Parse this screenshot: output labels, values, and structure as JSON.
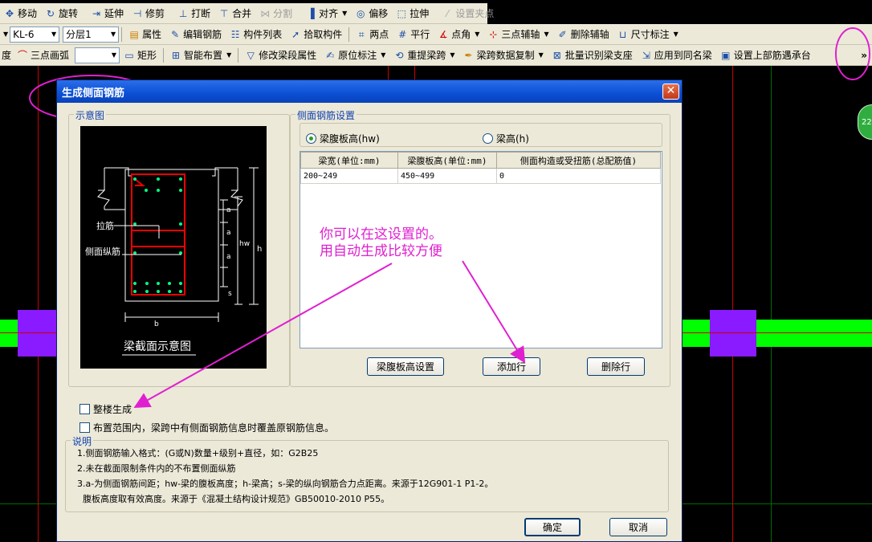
{
  "toolbar1": {
    "items": [
      "移动",
      "旋转",
      "延伸",
      "修剪",
      "打断",
      "合并",
      "分割",
      "对齐",
      "偏移",
      "拉伸",
      "设置夹点"
    ]
  },
  "toolbar2": {
    "component_select": "KL-6",
    "layer_select": "分层1",
    "items": [
      "属性",
      "编辑钢筋",
      "构件列表",
      "拾取构件",
      "两点",
      "平行",
      "点角",
      "三点辅轴",
      "删除辅轴",
      "尺寸标注"
    ]
  },
  "toolbar3": {
    "items": [
      "度",
      "三点画弧",
      "矩形",
      "智能布置",
      "修改梁段属性",
      "原位标注",
      "重提梁跨",
      "梁跨数据复制",
      "批量识别梁支座",
      "应用到同名梁",
      "设置上部筋遇承台"
    ],
    "overflow": "»"
  },
  "dialog": {
    "title": "生成侧面钢筋",
    "close": "✕",
    "diagram_group": "示意图",
    "diagram": {
      "label_tie": "拉筋",
      "label_side": "侧面纵筋",
      "caption": "梁截面示意图",
      "dim_a": "a",
      "dim_hw": "hw",
      "dim_h": "h",
      "dim_s": "s",
      "dim_b": "b"
    },
    "settings_group": "侧面钢筋设置",
    "radio_hw": "梁腹板高(hw)",
    "radio_h": "梁高(h)",
    "table": {
      "headers": [
        "梁宽(单位:mm)",
        "梁腹板高(单位:mm)",
        "侧面构造或受扭筋(总配筋值)"
      ],
      "rows": [
        [
          "200~249",
          "450~499",
          "0"
        ]
      ]
    },
    "btn_web_height": "梁腹板高设置",
    "btn_add_row": "添加行",
    "btn_delete_row": "删除行",
    "check_whole": "整楼生成",
    "check_overwrite": "布置范围内，梁跨中有侧面钢筋信息时覆盖原钢筋信息。",
    "notes_group": "说明",
    "notes": [
      "1.侧面钢筋输入格式：(G或N)数量+级别+直径，如：G2B25",
      "2.未在截面限制条件内的不布置侧面纵筋",
      "3.a-为侧面钢筋间距；hw-梁的腹板高度；h-梁高；s-梁的纵向钢筋合力点距离。来源于12G901-1 P1-2。",
      "  腹板高度取有效高度。来源于《混凝土结构设计规范》GB50010-2010 P55。"
    ],
    "btn_ok": "确定",
    "btn_cancel": "取消"
  },
  "annotation": {
    "line1": "你可以在这设置的。",
    "line2": "用自动生成比较方便"
  },
  "badge": "22",
  "colors": {
    "annotation": "#e020d0",
    "title_bar": "#0b4fd6",
    "beam_green": "#00ff00",
    "column_purple": "#8a1aff"
  }
}
